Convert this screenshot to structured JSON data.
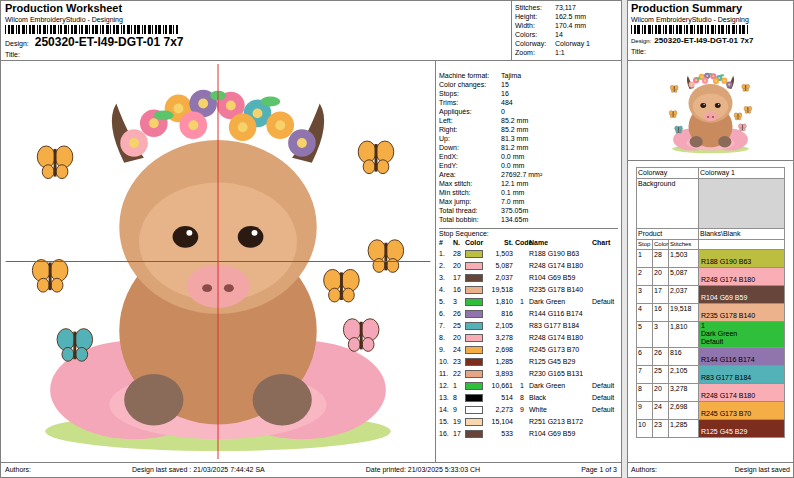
{
  "worksheet": {
    "title": "Production Worksheet",
    "app": "Wilcom EmbroideryStudio - Designing",
    "design_label": "Design:",
    "design": "250320-ET-I49-DGT-01 7x7",
    "title_label": "Title:",
    "summary": [
      {
        "label": "Stitches:",
        "value": "73,117"
      },
      {
        "label": "Height:",
        "value": "162.5 mm"
      },
      {
        "label": "Width:",
        "value": "170.4 mm"
      },
      {
        "label": "Colors:",
        "value": "14"
      },
      {
        "label": "Colorway:",
        "value": "Colorway 1"
      },
      {
        "label": "Zoom:",
        "value": "1:1"
      }
    ],
    "info": [
      {
        "label": "Machine format:",
        "value": "Tajima"
      },
      {
        "label": "Color changes:",
        "value": "15"
      },
      {
        "label": "Stops:",
        "value": "16"
      },
      {
        "label": "Trims:",
        "value": "484"
      },
      {
        "label": "Appliqués:",
        "value": "0"
      },
      {
        "label": "Left:",
        "value": "85.2 mm"
      },
      {
        "label": "Right:",
        "value": "85.2 mm"
      },
      {
        "label": "Up:",
        "value": "81.3 mm"
      },
      {
        "label": "Down:",
        "value": "81.2 mm"
      },
      {
        "label": "EndX:",
        "value": "0.0 mm"
      },
      {
        "label": "EndY:",
        "value": "0.0 mm"
      },
      {
        "label": "Area:",
        "value": "27692.7 mm²"
      },
      {
        "label": "Max stitch:",
        "value": "12.1 mm"
      },
      {
        "label": "Min stitch:",
        "value": "0.1 mm"
      },
      {
        "label": "Max jump:",
        "value": "7.0 mm"
      },
      {
        "label": "Total thread:",
        "value": "375.05m"
      },
      {
        "label": "Total bobbin:",
        "value": "134.65m"
      }
    ],
    "stop_sequence_label": "Stop Sequence:",
    "columns": [
      "#",
      "N.",
      "Color",
      "St.",
      "Code",
      "Name",
      "Chart"
    ],
    "stops": [
      {
        "num": "1.",
        "n": "28",
        "stitches": "1,503",
        "code": "",
        "name": "R188 G190 B63",
        "chart": "",
        "color": "#bcbe3f"
      },
      {
        "num": "2.",
        "n": "20",
        "stitches": "5,087",
        "code": "",
        "name": "R248 G174 B180",
        "chart": "",
        "color": "#f8aeb4"
      },
      {
        "num": "3.",
        "n": "17",
        "stitches": "2,037",
        "code": "",
        "name": "R104 G69 B59",
        "chart": "",
        "color": "#68453b"
      },
      {
        "num": "4.",
        "n": "16",
        "stitches": "19,518",
        "code": "",
        "name": "R235 G178 B140",
        "chart": "",
        "color": "#ebb28c"
      },
      {
        "num": "5.",
        "n": "3",
        "stitches": "1,810",
        "code": "1",
        "name": "Dark Green",
        "chart": "Default",
        "color": "#2fbf3a"
      },
      {
        "num": "6.",
        "n": "26",
        "stitches": "816",
        "code": "",
        "name": "R144 G116 B174",
        "chart": "",
        "color": "#9074ae"
      },
      {
        "num": "7.",
        "n": "25",
        "stitches": "2,105",
        "code": "",
        "name": "R83 G177 B184",
        "chart": "",
        "color": "#53b1b8"
      },
      {
        "num": "8.",
        "n": "20",
        "stitches": "3,278",
        "code": "",
        "name": "R248 G174 B180",
        "chart": "",
        "color": "#f8aeb4"
      },
      {
        "num": "9.",
        "n": "24",
        "stitches": "2,698",
        "code": "",
        "name": "R245 G173 B70",
        "chart": "",
        "color": "#f5ad46"
      },
      {
        "num": "10.",
        "n": "23",
        "stitches": "1,285",
        "code": "",
        "name": "R125 G45 B29",
        "chart": "",
        "color": "#7d2d1d"
      },
      {
        "num": "11.",
        "n": "22",
        "stitches": "3,893",
        "code": "",
        "name": "R230 G165 B131",
        "chart": "",
        "color": "#e6a583"
      },
      {
        "num": "12.",
        "n": "1",
        "stitches": "10,661",
        "code": "1",
        "name": "Dark Green",
        "chart": "Default",
        "color": "#2fbf3a"
      },
      {
        "num": "13.",
        "n": "8",
        "stitches": "514",
        "code": "8",
        "name": "Black",
        "chart": "Default",
        "color": "#000000"
      },
      {
        "num": "14.",
        "n": "9",
        "stitches": "2,273",
        "code": "9",
        "name": "White",
        "chart": "Default",
        "color": "#ffffff"
      },
      {
        "num": "15.",
        "n": "19",
        "stitches": "15,104",
        "code": "",
        "name": "R251 G213 B172",
        "chart": "",
        "color": "#fbd5ac"
      },
      {
        "num": "16.",
        "n": "17",
        "stitches": "533",
        "code": "",
        "name": "R104 G69 B59",
        "chart": "",
        "color": "#68453b"
      }
    ],
    "footer": {
      "authors": "Authors:",
      "saved": "Design last saved : 21/03/2025 7:44:42 SA",
      "printed": "Date printed: 21/03/2025 5:33:03 CH",
      "page": "Page 1 of 3"
    }
  },
  "summary": {
    "title": "Production Summary",
    "app": "Wilcom EmbroideryStudio - Designing",
    "design_label": "Design:",
    "design": "250320-ET-I49-DGT-01 7x7",
    "title_label": "Title:",
    "colorway_label": "Colorway",
    "colorway": "Colorway 1",
    "background_label": "Background",
    "product_label": "Product",
    "product": "Blanks\\Blank",
    "columns": [
      "Stop",
      "Color",
      "Stitches"
    ],
    "rows": [
      {
        "stop": "1",
        "n": "28",
        "stitches": "1,503",
        "lines": [
          "R188 G190 B63"
        ],
        "color": "#bcbe3f"
      },
      {
        "stop": "2",
        "n": "20",
        "stitches": "5,087",
        "lines": [
          "R248 G174 B180"
        ],
        "color": "#f8aeb4"
      },
      {
        "stop": "3",
        "n": "17",
        "stitches": "2,037",
        "lines": [
          "R104 G69 B59"
        ],
        "color": "#68453b"
      },
      {
        "stop": "4",
        "n": "16",
        "stitches": "19,518",
        "lines": [
          "R235 G178 B140"
        ],
        "color": "#ebb28c"
      },
      {
        "stop": "5",
        "n": "3",
        "stitches": "1,810",
        "lines": [
          "1",
          "Dark Green",
          "Default"
        ],
        "color": "#2fbf3a"
      },
      {
        "stop": "6",
        "n": "26",
        "stitches": "816",
        "lines": [
          "R144 G116 B174"
        ],
        "color": "#9074ae"
      },
      {
        "stop": "7",
        "n": "25",
        "stitches": "2,105",
        "lines": [
          "R83 G177 B184"
        ],
        "color": "#53b1b8"
      },
      {
        "stop": "8",
        "n": "20",
        "stitches": "3,278",
        "lines": [
          "R248 G174 B180"
        ],
        "color": "#f8aeb4"
      },
      {
        "stop": "9",
        "n": "24",
        "stitches": "2,698",
        "lines": [
          "R245 G173 B70"
        ],
        "color": "#f5ad46"
      },
      {
        "stop": "10",
        "n": "23",
        "stitches": "1,285",
        "lines": [
          "R125 G45 B29"
        ],
        "color": "#7d2d1d"
      }
    ],
    "footer": {
      "authors": "Authors:",
      "saved": "Design last saved"
    }
  }
}
